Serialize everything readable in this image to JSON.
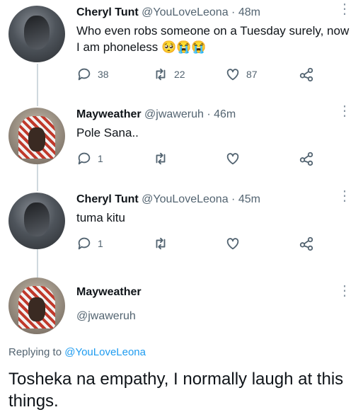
{
  "tweets": [
    {
      "name": "Cheryl Tunt",
      "handle": "@YouLoveLeona",
      "time": "48m",
      "text": "Who even robs someone on a Tuesday surely, now I am phoneless 🥺😭😭",
      "reply_count": "38",
      "retweet_count": "22",
      "like_count": "87"
    },
    {
      "name": "Mayweather",
      "handle": "@jwaweruh",
      "time": "46m",
      "text": "Pole Sana..",
      "reply_count": "1",
      "retweet_count": "",
      "like_count": ""
    },
    {
      "name": "Cheryl Tunt",
      "handle": "@YouLoveLeona",
      "time": "45m",
      "text": "tuma kitu",
      "reply_count": "1",
      "retweet_count": "",
      "like_count": ""
    }
  ],
  "main_tweet": {
    "name": "Mayweather",
    "handle": "@jwaweruh",
    "replying_to_label": "Replying to",
    "replying_to_handle": "@YouLoveLeona",
    "text": "Tosheka na empathy, I normally laugh at this things."
  },
  "separator": "·",
  "icons": [
    "reply-icon",
    "retweet-icon",
    "like-icon",
    "share-icon",
    "more-icon"
  ]
}
